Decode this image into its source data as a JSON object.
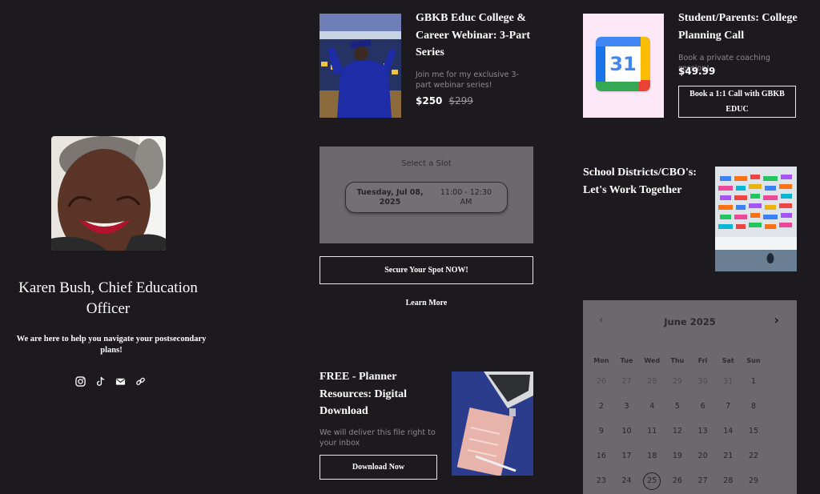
{
  "profile": {
    "name": "Karen Bush, Chief Education Officer",
    "tagline": "We are here to help you navigate your postsecondary plans!",
    "socials": [
      "instagram-icon",
      "tiktok-icon",
      "mail-icon",
      "link-icon"
    ]
  },
  "webinar": {
    "title": "GBKB Educ College & Career Webinar: 3-Part Series",
    "desc": "Join me for my exclusive 3-part webinar series!",
    "price": "$250",
    "old_price": "$299"
  },
  "slot": {
    "heading": "Select a Slot",
    "date": "Tuesday, Jul 08, 2025",
    "time": "11:00 - 12:30 AM",
    "cta": "Secure Your Spot NOW!",
    "learn_more": "Learn More"
  },
  "planner": {
    "title": "FREE - Planner Resources: Digital Download",
    "desc": "We will deliver this file right to your inbox",
    "cta": "Download Now"
  },
  "call": {
    "title": "Student/Parents: College Planning Call",
    "desc": "Book a private coaching session!",
    "price": "$49.99",
    "cta": "Book a 1:1 Call with GBKB EDUC",
    "icon_day": "31"
  },
  "districts": {
    "title": "School Districts/CBO's: Let's Work Together"
  },
  "calendar": {
    "month": "June 2025",
    "weekdays": [
      "Mon",
      "Tue",
      "Wed",
      "Thu",
      "Fri",
      "Sat",
      "Sun"
    ],
    "selected": "25",
    "weeks": [
      [
        "26",
        "27",
        "28",
        "29",
        "30",
        "31",
        "1"
      ],
      [
        "2",
        "3",
        "4",
        "5",
        "6",
        "7",
        "8"
      ],
      [
        "9",
        "10",
        "11",
        "12",
        "13",
        "14",
        "15"
      ],
      [
        "16",
        "17",
        "18",
        "19",
        "20",
        "21",
        "22"
      ],
      [
        "23",
        "24",
        "25",
        "26",
        "27",
        "28",
        "29"
      ]
    ]
  },
  "colors": {
    "background": "#1c1a1e",
    "overlay": "#6b696e",
    "call_thumb_bg": "#fce8f6"
  }
}
